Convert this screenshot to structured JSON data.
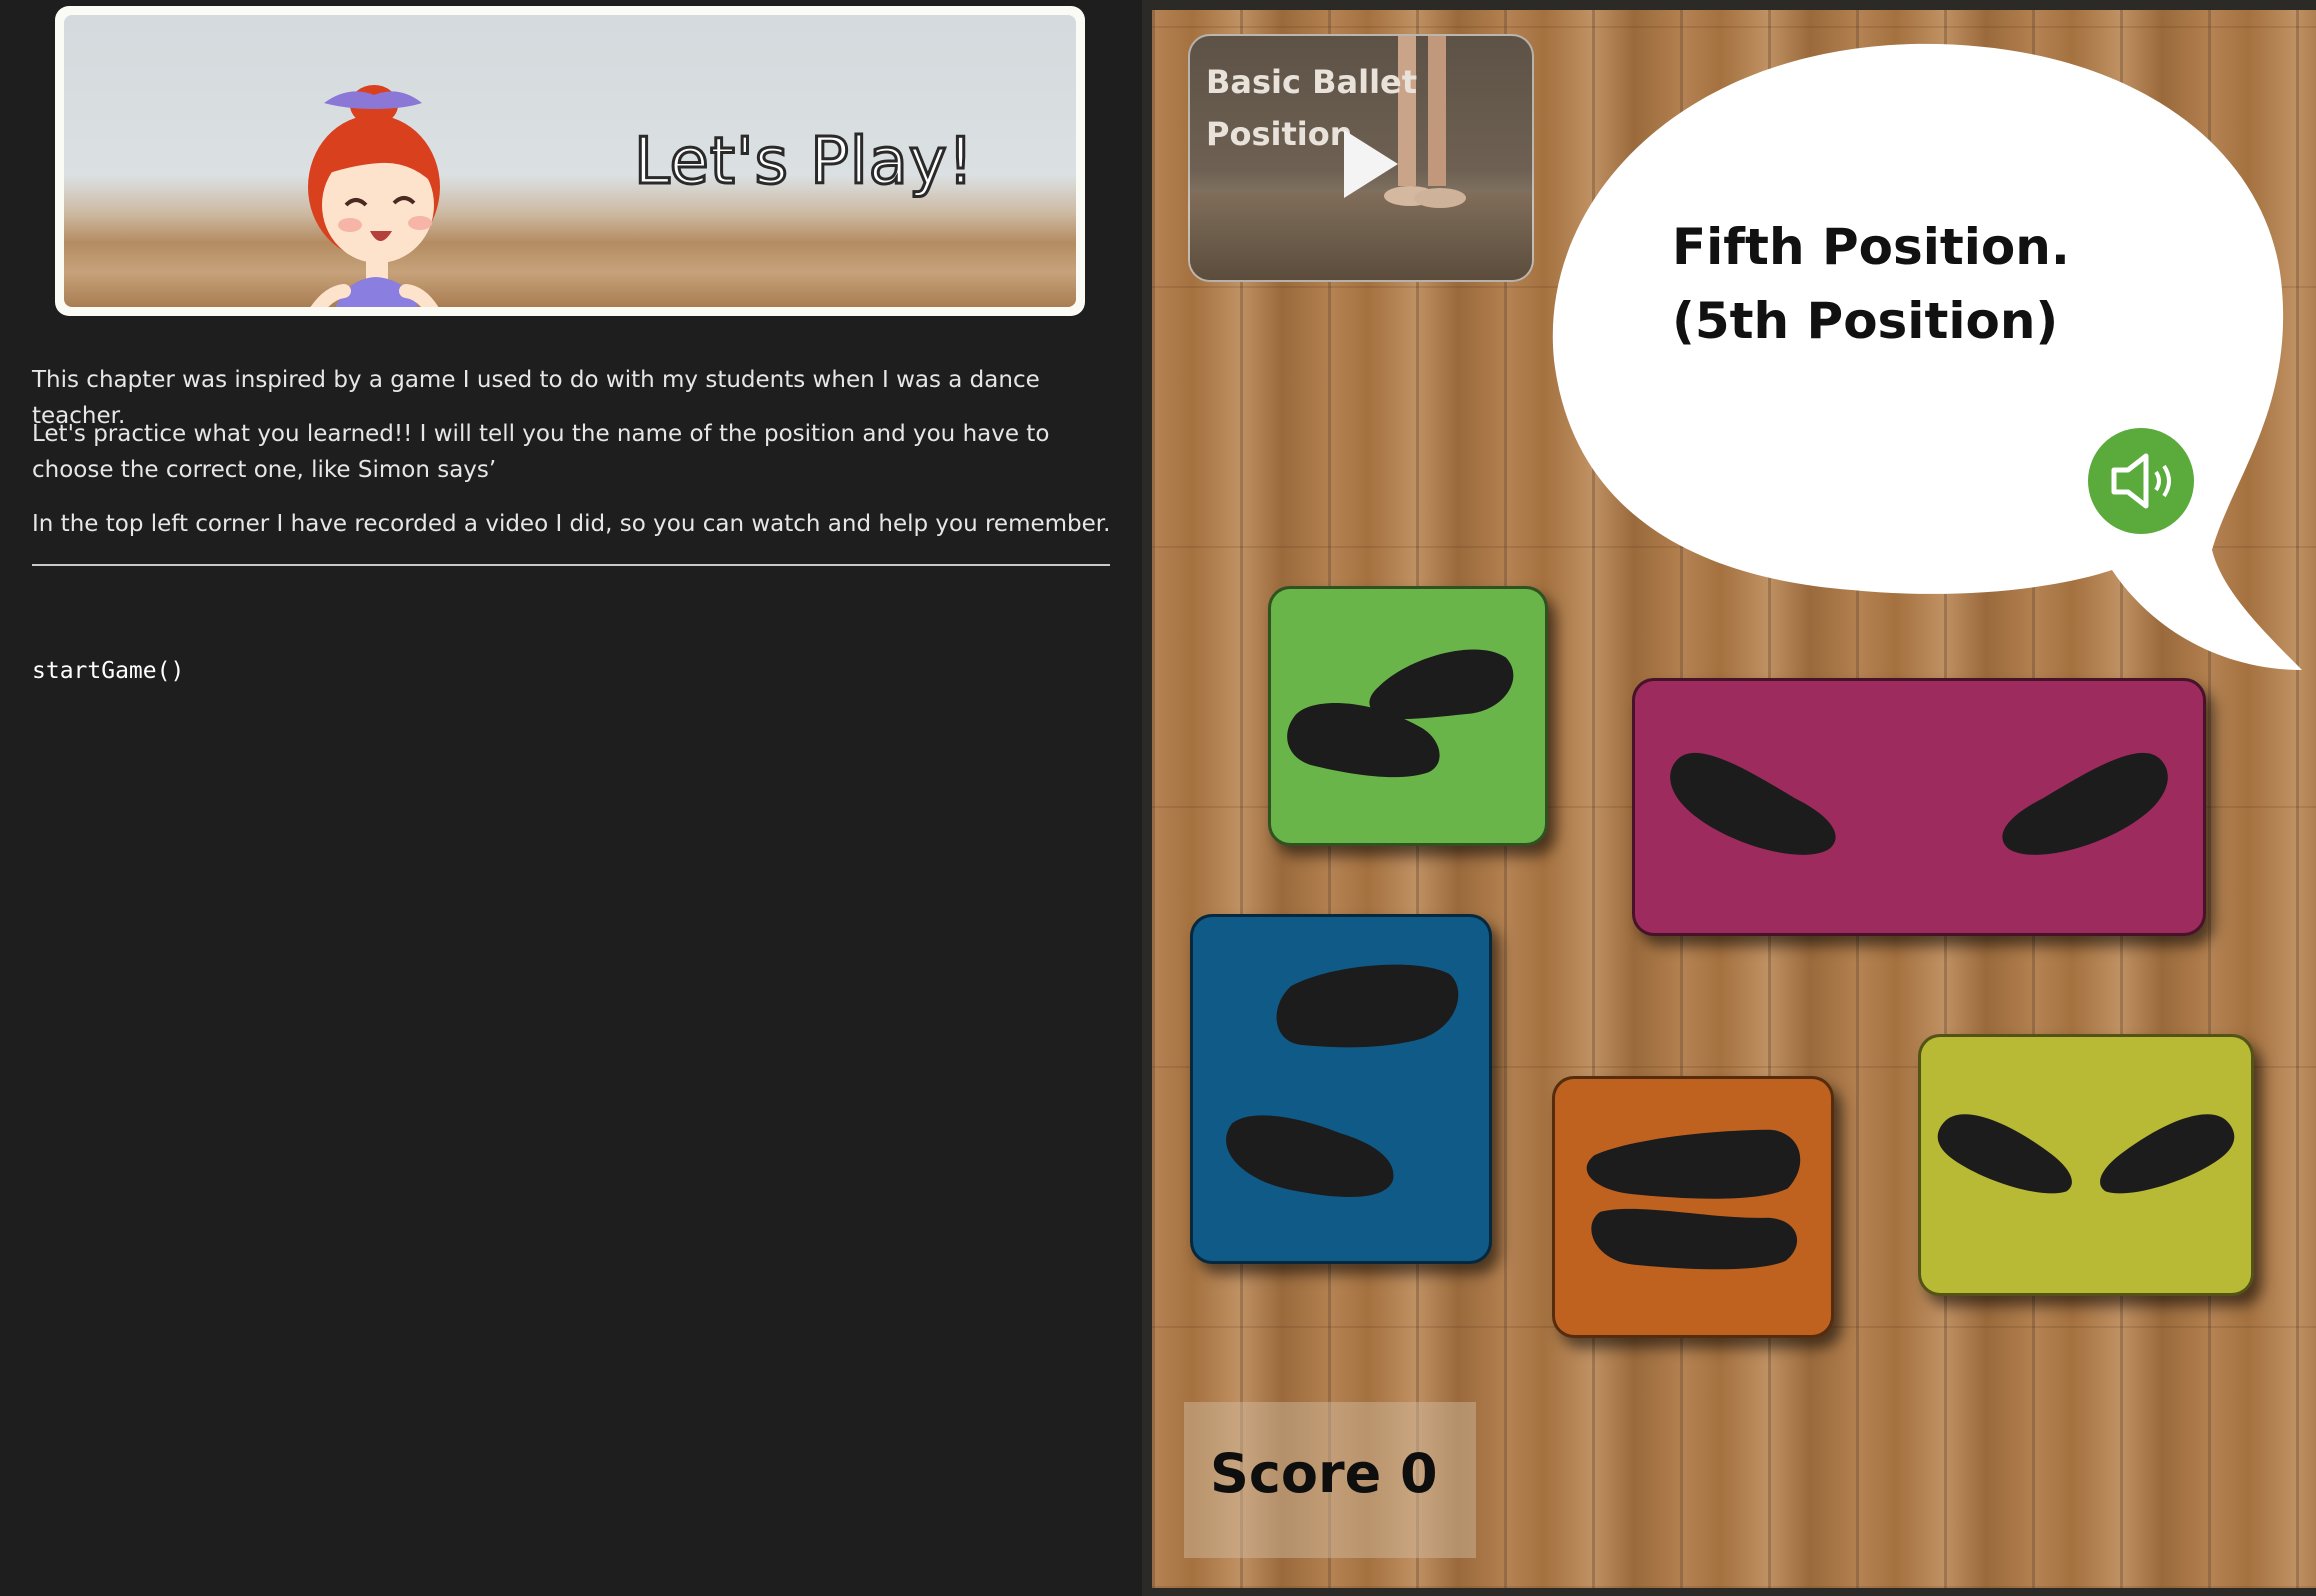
{
  "banner": {
    "text": "Let's Play!"
  },
  "intro": {
    "p1": "This chapter was inspired by a game I used to do with my students when I was a dance teacher.",
    "p2": "Let's practice what you learned!! I will tell you the name of the position and you have to choose the correct one, like Simon says’",
    "p3": "In the top left corner I have recorded a video I did, so you can watch and help you remember."
  },
  "code": {
    "line": "startGame()"
  },
  "game": {
    "video": {
      "title": "Basic Ballet Position",
      "icon": "play-icon"
    },
    "prompt": {
      "line1": "Fifth Position.",
      "line2": "(5th Position)"
    },
    "sound_icon": "speaker-icon",
    "cards": [
      {
        "id": "green",
        "color": "#6ab54a"
      },
      {
        "id": "magenta",
        "color": "#9e2b5e"
      },
      {
        "id": "blue",
        "color": "#0f5a87"
      },
      {
        "id": "orange",
        "color": "#bf6220"
      },
      {
        "id": "lime",
        "color": "#b8b934"
      }
    ],
    "score": {
      "label": "Score",
      "value": "0"
    }
  }
}
